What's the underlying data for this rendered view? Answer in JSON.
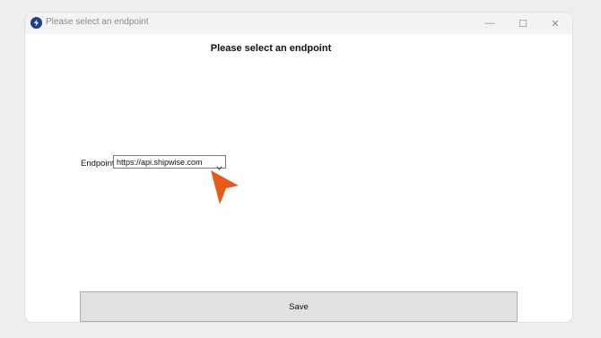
{
  "window": {
    "title": "Please select an endpoint",
    "controls": {
      "minimize": "—",
      "maximize": "☐",
      "close": "✕"
    }
  },
  "form": {
    "heading": "Please select an endpoint",
    "endpoint_label": "Endpoint",
    "endpoint_value": "https://api.shipwise.com"
  },
  "actions": {
    "save_label": "Save"
  },
  "icons": {
    "app": "app-logo-icon",
    "dropdown": "chevron-down-icon",
    "pointer": "mouse-pointer-icon"
  },
  "colors": {
    "app_icon": "#1c3f8f",
    "pointer": "#e8591a",
    "button_bg": "#e1e1e1"
  }
}
